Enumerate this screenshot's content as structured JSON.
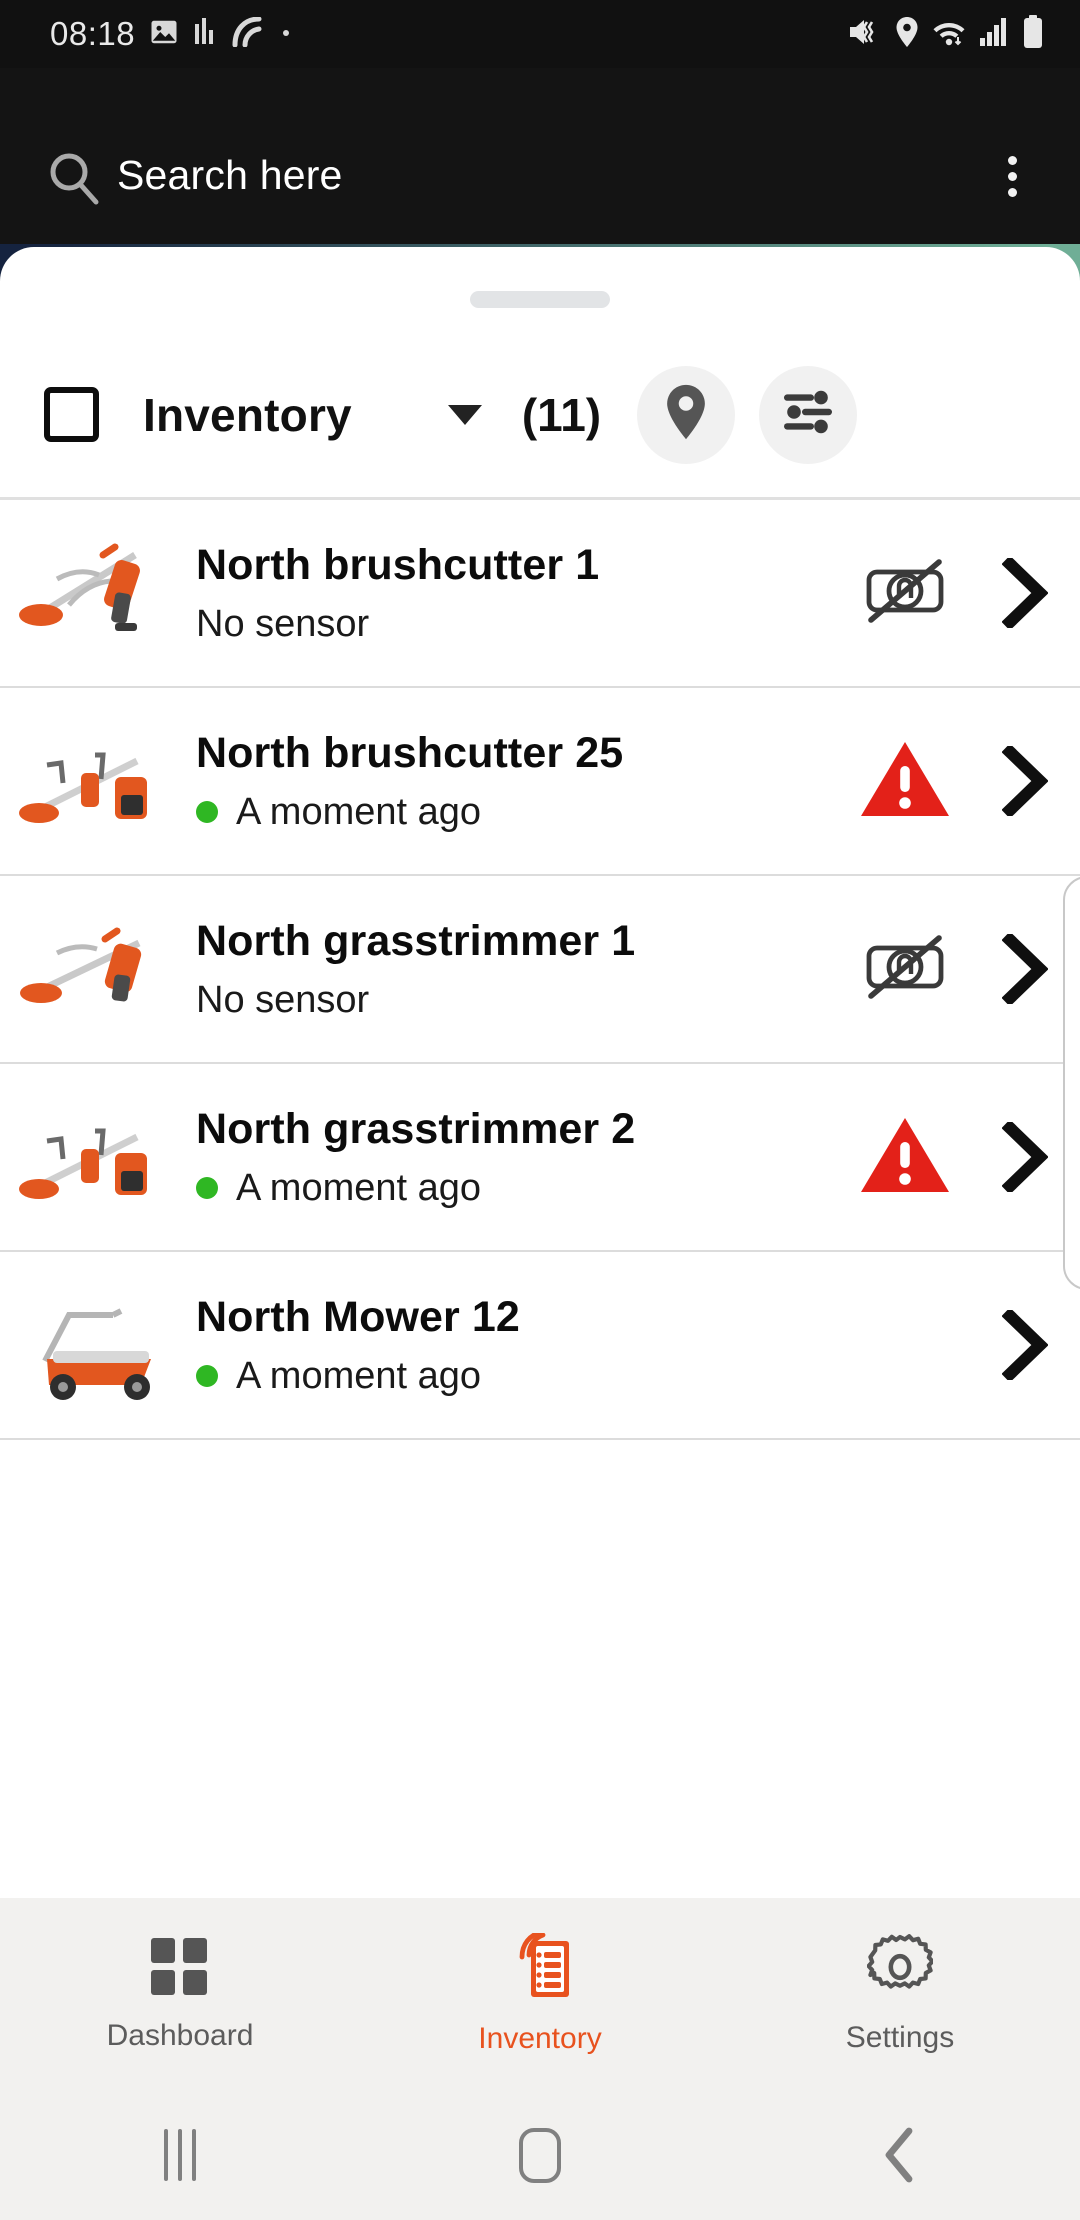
{
  "status_bar": {
    "time": "08:18",
    "left_icons": [
      "gallery-icon",
      "equalizer-icon",
      "nfc-icon",
      "dot-icon"
    ],
    "right_icons": [
      "mute-vibrate-icon",
      "location-icon",
      "wifi-icon",
      "signal-icon",
      "battery-icon"
    ]
  },
  "search": {
    "placeholder": "Search here",
    "icon": "search-icon",
    "overflow_icon": "overflow-menu-icon"
  },
  "toolbar": {
    "checkbox_name": "select-all-checkbox",
    "title": "Inventory",
    "caret_icon": "chevron-down-icon",
    "count": "(11)",
    "map_button_icon": "location-pin-icon",
    "filter_button_icon": "filter-sliders-icon"
  },
  "list": {
    "items": [
      {
        "title": "North brushcutter 1",
        "status": "No sensor",
        "has_dot": false,
        "alert": "no-sensor-icon",
        "thumb": "brushcutter-thumbnail",
        "chevron": "chevron-right-icon"
      },
      {
        "title": "North brushcutter 25",
        "status": "A moment ago",
        "has_dot": true,
        "alert": "warning-triangle-icon",
        "thumb": "brushcutter-thumbnail",
        "chevron": "chevron-right-icon"
      },
      {
        "title": "North grasstrimmer 1",
        "status": "No sensor",
        "has_dot": false,
        "alert": "no-sensor-icon",
        "thumb": "grasstrimmer-thumbnail",
        "chevron": "chevron-right-icon"
      },
      {
        "title": "North grasstrimmer 2",
        "status": "A moment ago",
        "has_dot": true,
        "alert": "warning-triangle-icon",
        "thumb": "grasstrimmer-thumbnail",
        "chevron": "chevron-right-icon"
      },
      {
        "title": "North Mower 12",
        "status": "A moment ago",
        "has_dot": true,
        "alert": "",
        "thumb": "mower-thumbnail",
        "chevron": "chevron-right-icon"
      }
    ]
  },
  "tabs": [
    {
      "label": "Dashboard",
      "icon": "grid-icon",
      "active": false
    },
    {
      "label": "Inventory",
      "icon": "inventory-document-icon",
      "active": true
    },
    {
      "label": "Settings",
      "icon": "gear-icon",
      "active": false
    }
  ],
  "nav_bar": {
    "recents_icon": "recents-icon",
    "home_icon": "home-icon",
    "back_icon": "back-chevron-icon"
  },
  "colors": {
    "accent": "#e8521e",
    "alert": "#e32119",
    "online": "#2fb723",
    "status_bar_bg": "#111111",
    "search_bg": "#141414",
    "tabbar_bg": "#f2f1ef"
  }
}
